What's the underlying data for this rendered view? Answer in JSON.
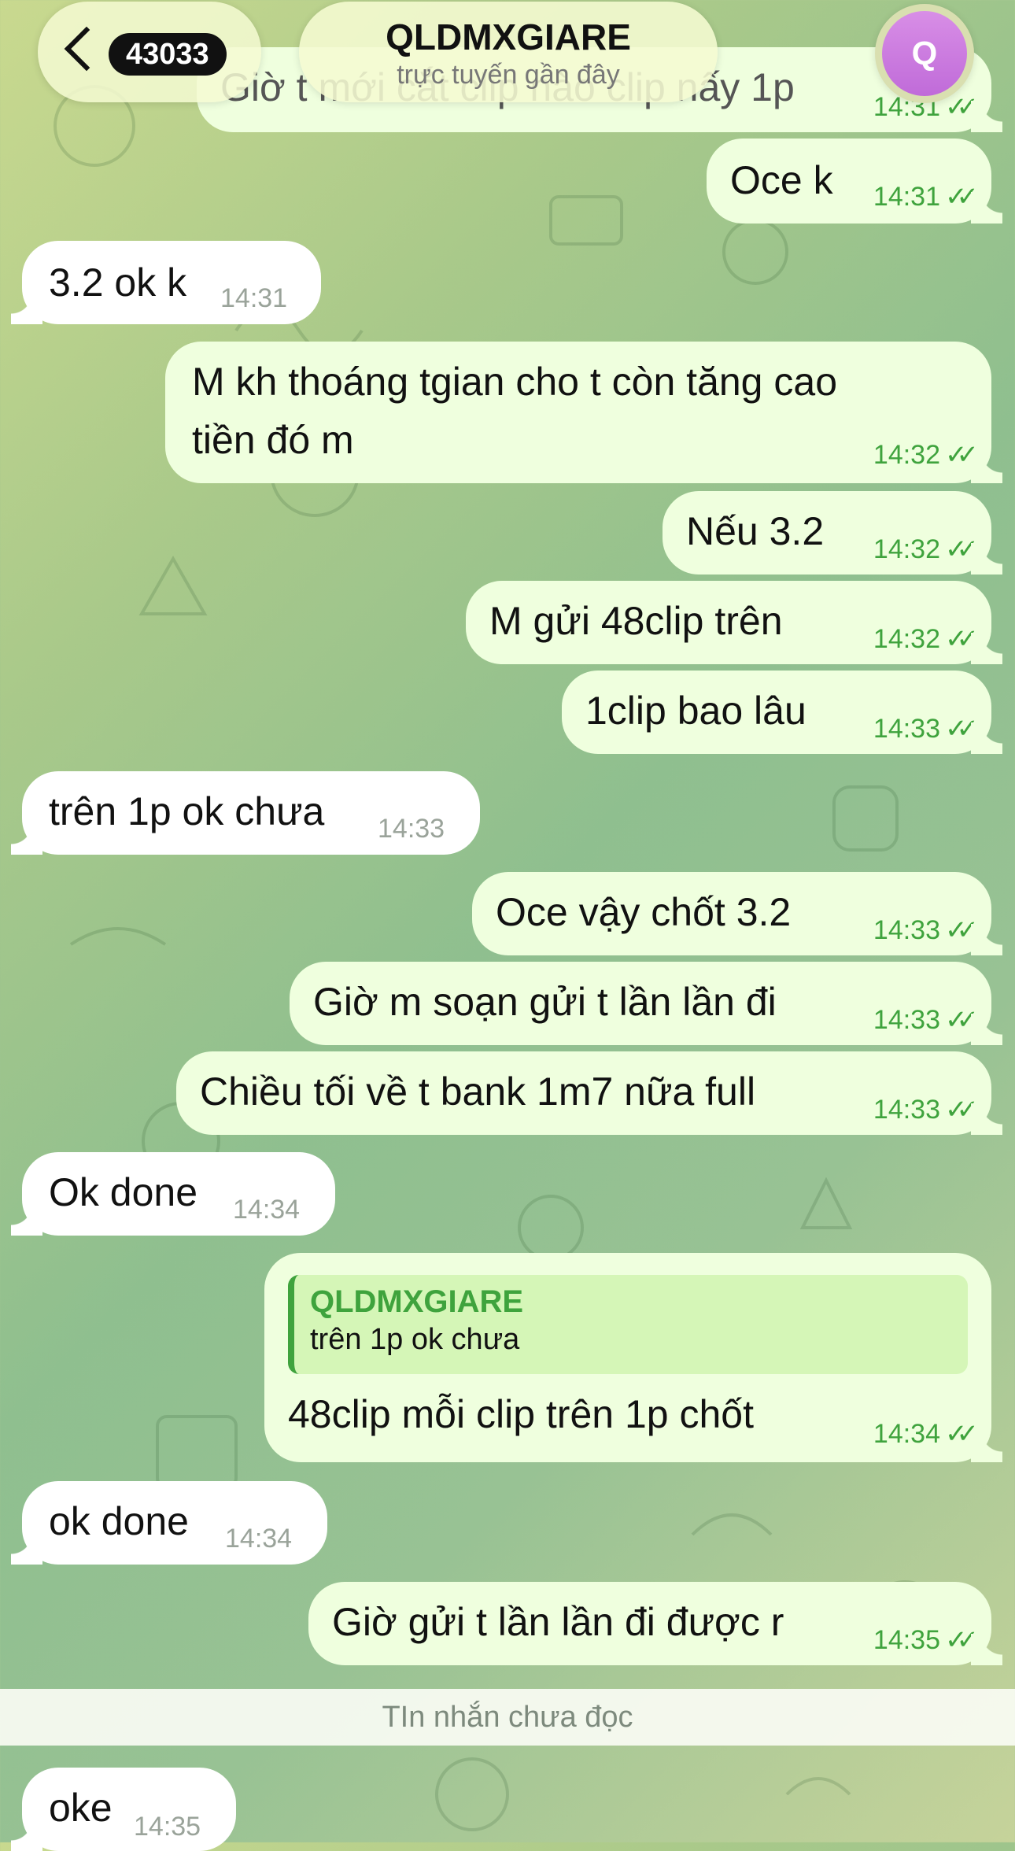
{
  "header": {
    "back_count": "43033",
    "name": "QLDMXGIARE",
    "status": "trực tuyến gần đây",
    "avatar_initial": "Q"
  },
  "messages": [
    {
      "text": "Giờ t mới cắt clip nào clip nấy 1p",
      "time": "14:31"
    },
    {
      "text": "Oce k",
      "time": "14:31"
    },
    {
      "text": "3.2 ok k",
      "time": "14:31"
    },
    {
      "line1": "M kh thoáng tgian cho t còn tăng cao",
      "line2": "tiền đó m",
      "time": "14:32"
    },
    {
      "text": "Nếu 3.2",
      "time": "14:32"
    },
    {
      "text": "M gửi 48clip trên",
      "time": "14:32"
    },
    {
      "text": "1clip bao lâu",
      "time": "14:33"
    },
    {
      "text": "trên 1p ok chưa",
      "time": "14:33"
    },
    {
      "text": "Oce vậy chốt 3.2",
      "time": "14:33"
    },
    {
      "text": "Giờ m soạn gửi t lần lần đi",
      "time": "14:33"
    },
    {
      "text": "Chiều tối về t bank 1m7 nữa full",
      "time": "14:33"
    },
    {
      "text": "Ok done",
      "time": "14:34"
    },
    {
      "reply_name": "QLDMXGIARE",
      "reply_text": "trên 1p ok chưa",
      "text": "48clip mỗi clip trên 1p chốt",
      "time": "14:34"
    },
    {
      "text": "ok done",
      "time": "14:34"
    },
    {
      "text": "Giờ gửi t lần lần đi được r",
      "time": "14:35"
    },
    {
      "text": "oke",
      "time": "14:35"
    }
  ],
  "unread_label": "TIn nhắn chưa đọc",
  "colors": {
    "outgoing": "#efffde",
    "incoming": "#ffffff",
    "accent": "#3fa33d"
  },
  "icons": [
    "back-chevron-icon",
    "double-check-icon"
  ]
}
